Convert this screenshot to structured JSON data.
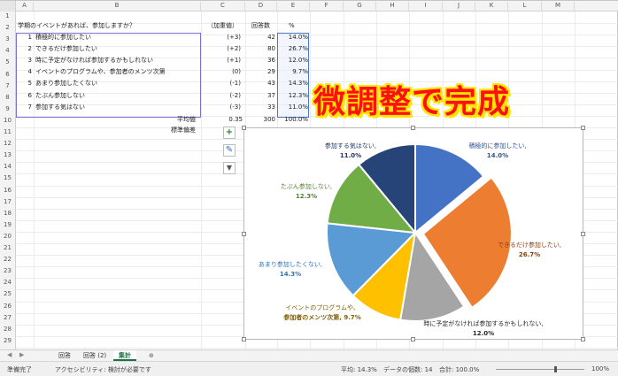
{
  "columns": [
    "A",
    "B",
    "C",
    "D",
    "E",
    "F",
    "G",
    "H",
    "I",
    "J",
    "K",
    "L",
    "M"
  ],
  "rows": [
    "1",
    "2",
    "3",
    "4",
    "5",
    "6",
    "7",
    "8",
    "9",
    "10",
    "11",
    "12",
    "13",
    "14",
    "15",
    "16",
    "17",
    "18",
    "19",
    "20",
    "21",
    "22",
    "23",
    "24",
    "25",
    "26",
    "27",
    "28",
    "29"
  ],
  "sheet": {
    "b1": "学期のイベントがあれば、参加しますか？",
    "c1": "（加重値）",
    "d1": "回答数",
    "e1": "%",
    "items": [
      {
        "n": "1",
        "label": "積極的に参加したい",
        "weight": "(+3)",
        "count": "42",
        "pct": "14.0%"
      },
      {
        "n": "2",
        "label": "できるだけ参加したい",
        "weight": "(+2)",
        "count": "80",
        "pct": "26.7%"
      },
      {
        "n": "3",
        "label": "時に予定がなければ参加するかもしれない",
        "weight": "(+1)",
        "count": "36",
        "pct": "12.0%"
      },
      {
        "n": "4",
        "label": "イベントのプログラムや、参加者のメンツ次第",
        "weight": "(0)",
        "count": "29",
        "pct": "9.7%"
      },
      {
        "n": "5",
        "label": "あまり参加したくない",
        "weight": "(-1)",
        "count": "43",
        "pct": "14.3%"
      },
      {
        "n": "6",
        "label": "たぶん参加しない",
        "weight": "(-2)",
        "count": "37",
        "pct": "12.3%"
      },
      {
        "n": "7",
        "label": "参加する気はない",
        "weight": "(-3)",
        "count": "33",
        "pct": "11.0%"
      }
    ],
    "avg_label": "平均値",
    "avg_value": "0.35",
    "total_count": "300",
    "total_pct": "100.0%",
    "sd_label": "標準偏差"
  },
  "banner": "微調整で完成",
  "side_buttons": {
    "add": "+",
    "brush": "✎",
    "filter": "▼"
  },
  "chart_data": {
    "type": "pie",
    "slices": [
      {
        "name": "積極的に参加したい,",
        "value": 14.0,
        "label": "14.0%",
        "color": "#4472c4"
      },
      {
        "name": "できるだけ参加したい,",
        "value": 26.7,
        "label": "26.7%",
        "color": "#ed7d31"
      },
      {
        "name": "時に予定がなければ参加するかもしれない,",
        "value": 12.0,
        "label": "12.0%",
        "color": "#a5a5a5"
      },
      {
        "name": "イベントのプログラムや、参加者のメンツ次第,",
        "value": 9.7,
        "label": "9.7%",
        "color": "#ffc000"
      },
      {
        "name": "あまり参加したくない,",
        "value": 14.3,
        "label": "14.3%",
        "color": "#5b9bd5"
      },
      {
        "name": "たぶん参加しない,",
        "value": 12.3,
        "label": "12.3%",
        "color": "#70ad47"
      },
      {
        "name": "参加する気はない,",
        "value": 11.0,
        "label": "11.0%",
        "color": "#264478"
      }
    ],
    "label_lines": {
      "s0": [
        "積極的に参加したい,",
        "14.0%"
      ],
      "s1": [
        "できるだけ参加したい,",
        "26.7%"
      ],
      "s2": [
        "時に予定がなければ参加するかもしれない,",
        "12.0%"
      ],
      "s3": [
        "イベントのプログラムや、",
        "参加者のメンツ次第, 9.7%"
      ],
      "s4": [
        "あまり参加したくない,",
        "14.3%"
      ],
      "s5": [
        "たぶん参加しない,",
        "12.3%"
      ],
      "s6": [
        "参加する気はない,",
        "11.0%"
      ]
    }
  },
  "tabs": [
    "回答",
    "回答 (2)",
    "集計"
  ],
  "tab_add": "⊕",
  "status": {
    "ready": "準備完了",
    "accessibility": "アクセシビリティ: 検討が必要です",
    "average": "平均: 14.3%",
    "count": "データの個数: 14",
    "sum": "合計: 100.0%",
    "zoom": "100%"
  }
}
